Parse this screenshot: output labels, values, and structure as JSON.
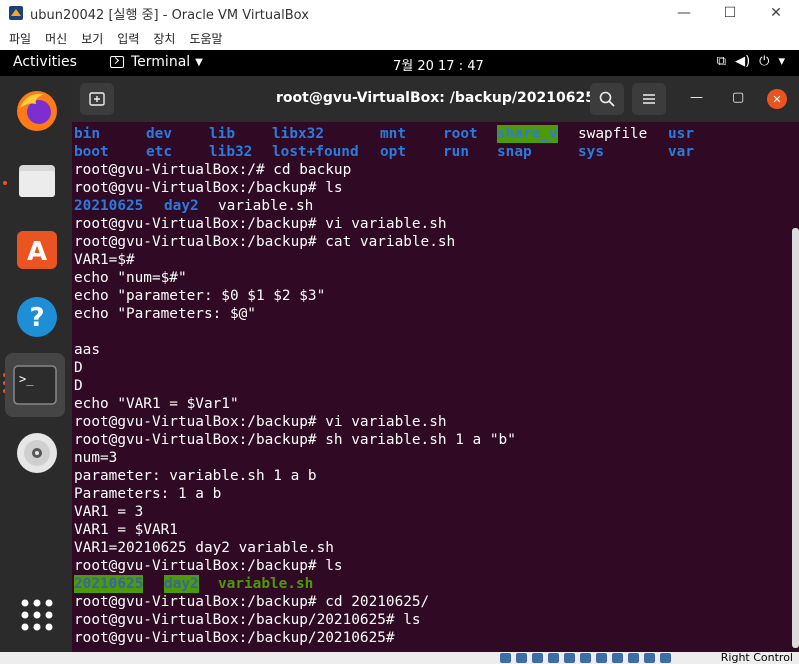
{
  "host": {
    "title": "ubun20042 [실행 중] - Oracle VM VirtualBox",
    "minimize": "—",
    "maximize": "☐",
    "close": "✕",
    "menu": [
      "파일",
      "머신",
      "보기",
      "입력",
      "장치",
      "도움말"
    ],
    "status_keyboard": "Right Control"
  },
  "topbar": {
    "activities": "Activities",
    "app_name": "Terminal",
    "clock": "7월 20  17 : 47",
    "tray": {
      "network": "⧉",
      "volume": "◀)",
      "power": "⏻",
      "dropdown": "▾"
    }
  },
  "dock": {
    "apps": [
      "firefox",
      "files",
      "software",
      "help",
      "terminal",
      "cd",
      "show-apps"
    ]
  },
  "terminal": {
    "title": "root@gvu-VirtualBox: /backup/20210625",
    "ls_root": {
      "row1": [
        "bin",
        "dev",
        "lib",
        "libx32",
        "mnt",
        "root",
        "share_v",
        "swapfile",
        "usr"
      ],
      "row2": [
        "boot",
        "etc",
        "lib32",
        "lost+found",
        "opt",
        "run",
        "snap",
        "sys",
        "var"
      ]
    },
    "lines": [
      "root@gvu-VirtualBox:/# cd backup",
      "root@gvu-VirtualBox:/backup# ls",
      "",
      "root@gvu-VirtualBox:/backup# vi variable.sh",
      "root@gvu-VirtualBox:/backup# cat variable.sh",
      "VAR1=$#",
      "echo \"num=$#\"",
      "echo \"parameter: $0 $1 $2 $3\"",
      "echo \"Parameters: $@\"",
      "",
      "aas",
      "D",
      "D",
      "echo \"VAR1 = $Var1\"",
      "root@gvu-VirtualBox:/backup# vi variable.sh",
      "root@gvu-VirtualBox:/backup# sh variable.sh 1 a \"b\"",
      "num=3",
      "parameter: variable.sh 1 a b",
      "Parameters: 1 a b",
      "VAR1 = 3",
      "VAR1 = $VAR1",
      "VAR1=20210625 day2 variable.sh",
      "root@gvu-VirtualBox:/backup# ls",
      "",
      "root@gvu-VirtualBox:/backup# cd 20210625/",
      "root@gvu-VirtualBox:/backup/20210625# ls",
      "root@gvu-VirtualBox:/backup/20210625#"
    ],
    "ls1": {
      "dir1": "20210625",
      "dir2": "day2",
      "file": "variable.sh"
    },
    "ls2": {
      "dir1": "20210625",
      "dir2": "day2",
      "file": "variable.sh"
    }
  },
  "colors": {
    "terminal_bg": "#300a24",
    "dir_blue": "#2a7bde",
    "highlight_green": "#4e9a06",
    "ubuntu_orange": "#e95420"
  }
}
